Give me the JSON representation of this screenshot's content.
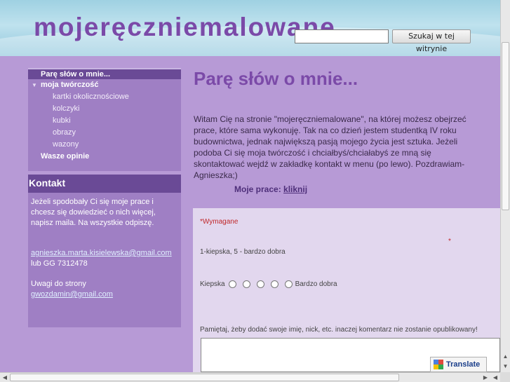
{
  "header": {
    "site_title": "mojeręczniemalowane",
    "search_placeholder": "",
    "search_button": "Szukaj w tej witrynie"
  },
  "nav": {
    "items": [
      {
        "label": "Parę słów o mnie..."
      },
      {
        "label": "moja twórczość"
      },
      {
        "label": "kartki okolicznościowe"
      },
      {
        "label": "kolczyki"
      },
      {
        "label": "kubki"
      },
      {
        "label": "obrazy"
      },
      {
        "label": "wazony"
      },
      {
        "label": "Wasze opinie"
      }
    ]
  },
  "contact": {
    "heading": "Kontakt",
    "text": "Jeżeli spodobały Ci się moje prace i chcesz się dowiedzieć o nich więcej, napisz maila. Na wszystkie odpiszę.",
    "email": "agnieszka.marta.kisielewska@gmail.com",
    "gg": "lub GG 7312478",
    "remarks_label": "Uwagi do strony",
    "remarks_email": "gwozdamin@gmail.com"
  },
  "main": {
    "title": "Parę słów o mnie...",
    "intro": "Witam Cię na stronie \"mojeręczniemalowane\", na której możesz obejrzeć prace, które sama wykonuję. Tak na co dzień jestem studentką IV roku budownictwa, jednak największą pasją mojego życia jest sztuka. Jeżeli podoba Ci się moja twórczość i chciałbyś/chciałabyś ze mną się skontaktować wejdź w zakładkę kontakt w menu (po lewo). Pozdrawiam-Agnieszka;)",
    "works_label": "Moje prace:",
    "works_link": "kliknij"
  },
  "form": {
    "required": "*Wymagane",
    "star": "*",
    "scale": "1-kiepska, 5 - bardzo dobra",
    "rating_low": "Kiepska",
    "rating_high": "Bardzo dobra",
    "remember": "Pamiętaj, żeby dodać swoje imię, nick, etc. inaczej komentarz nie zostanie opublikowany!",
    "translate": "Translate"
  },
  "colors": {
    "background": "#b79ad6",
    "accent": "#7b4aa8",
    "nav_dark": "#6a4a96"
  }
}
